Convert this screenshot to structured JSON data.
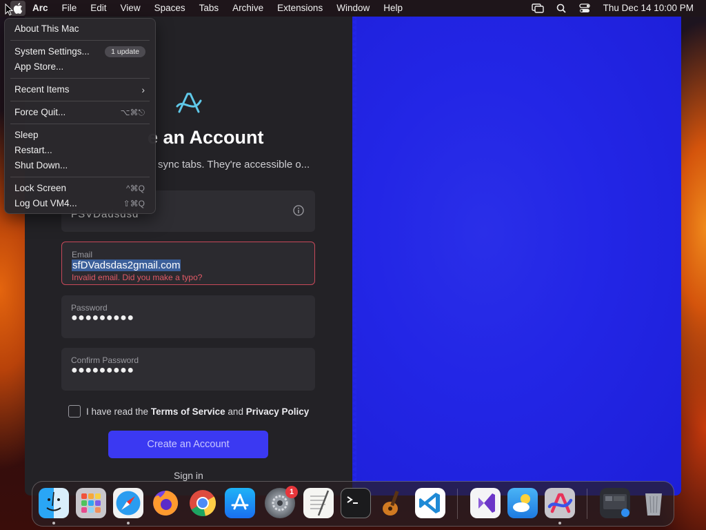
{
  "menubar": {
    "app_name": "Arc",
    "menus": [
      "File",
      "Edit",
      "View",
      "Spaces",
      "Tabs",
      "Archive",
      "Extensions",
      "Window",
      "Help"
    ],
    "status_icons": [
      "screen-mirroring-icon",
      "spotlight-search-icon",
      "control-center-icon"
    ],
    "clock": "Thu Dec 14  10:00 PM"
  },
  "apple_menu": {
    "about": "About This Mac",
    "system_settings": "System Settings...",
    "system_settings_badge": "1 update",
    "app_store": "App Store...",
    "recent_items": "Recent Items",
    "force_quit": "Force Quit...",
    "force_quit_shortcut": "⌥⌘⎋",
    "sleep": "Sleep",
    "restart": "Restart...",
    "shut_down": "Shut Down...",
    "lock_screen": "Lock Screen",
    "lock_screen_shortcut": "^⌘Q",
    "log_out": "Log Out VM4...",
    "log_out_shortcut": "⇧⌘Q"
  },
  "signup": {
    "heading_visible": "e an Account",
    "subtext_visible": "sync tabs. They're accessible o...",
    "name_field_value_partial": "FSVDadsdsd",
    "email": {
      "label": "Email",
      "value": "sfDVadsdas2gmail.com",
      "error": "Invalid email. Did you make a typo?"
    },
    "password": {
      "label": "Password",
      "value": "●●●●●●●●●"
    },
    "confirm_password": {
      "label": "Confirm Password",
      "value": "●●●●●●●●●"
    },
    "terms": {
      "prefix": "I have read the",
      "tos": "Terms of Service",
      "and": "and",
      "privacy": "Privacy Policy",
      "checked": false
    },
    "create_button": "Create an Account",
    "sign_in_link": "Sign in"
  },
  "dock": {
    "apps": [
      {
        "name": "Finder",
        "icon": "finder-icon",
        "running": true
      },
      {
        "name": "Launchpad",
        "icon": "launchpad-icon",
        "running": false
      },
      {
        "name": "Safari",
        "icon": "safari-icon",
        "running": true
      },
      {
        "name": "Firefox",
        "icon": "firefox-icon",
        "running": false
      },
      {
        "name": "Chrome",
        "icon": "chrome-icon",
        "running": false
      },
      {
        "name": "App Store",
        "icon": "app-store-icon",
        "running": false
      },
      {
        "name": "System Settings",
        "icon": "system-settings-icon",
        "running": false,
        "badge": "1"
      },
      {
        "name": "TextEdit",
        "icon": "textedit-icon",
        "running": false
      },
      {
        "name": "Terminal",
        "icon": "terminal-icon",
        "running": false
      },
      {
        "name": "GarageBand",
        "icon": "garageband-icon",
        "running": false
      },
      {
        "name": "VS Code",
        "icon": "vscode-icon",
        "running": false
      },
      {
        "name": "Visual Studio",
        "icon": "visual-studio-icon",
        "running": false
      },
      {
        "name": "Weather",
        "icon": "weather-icon",
        "running": false
      },
      {
        "name": "Arc",
        "icon": "arc-icon",
        "running": true
      },
      {
        "name": "Downloads stack",
        "icon": "downloads-stack-icon",
        "running": false
      },
      {
        "name": "Trash",
        "icon": "trash-icon",
        "running": false
      }
    ]
  },
  "colors": {
    "accent_button": "#3b39f2",
    "error": "#e25a66",
    "blue_pane": "#2326e6"
  }
}
